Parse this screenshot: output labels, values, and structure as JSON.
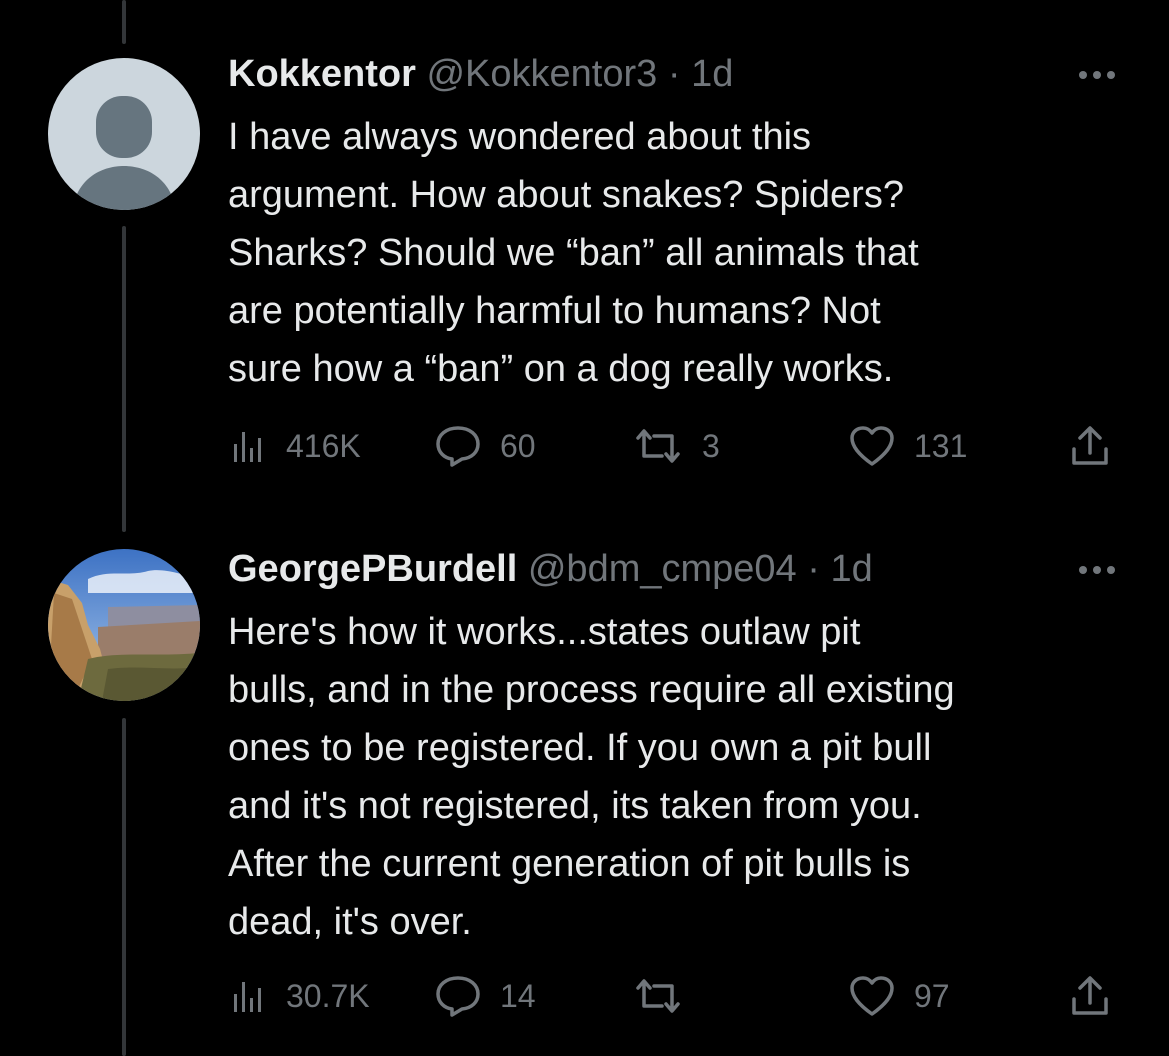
{
  "colors": {
    "background": "#000000",
    "text_primary": "#e7e9ea",
    "text_secondary": "#71767b",
    "thread_line": "#333639"
  },
  "tweets": [
    {
      "display_name": "Kokkentor",
      "handle": "@Kokkentor3",
      "separator": "·",
      "time": "1d",
      "avatar": "default-profile-avatar",
      "text": "I have always wondered about this\nargument. How about snakes? Spiders?\nSharks? Should we “ban” all animals that\nare potentially harmful to humans? Not\nsure how a “ban” on a dog really works.",
      "views": "416K",
      "replies": "60",
      "retweets": "3",
      "likes": "131"
    },
    {
      "display_name": "GeorgePBurdell",
      "handle": "@bdm_cmpe04",
      "separator": "·",
      "time": "1d",
      "avatar": "canyon-landscape-photo",
      "text": "Here's how it works...states outlaw pit\nbulls, and in the process require all existing\nones to be registered.  If you own a pit bull\nand it's not registered, its taken from you.\nAfter the current generation of pit bulls is\ndead, it's over.",
      "views": "30.7K",
      "replies": "14",
      "retweets": "",
      "likes": "97"
    }
  ]
}
